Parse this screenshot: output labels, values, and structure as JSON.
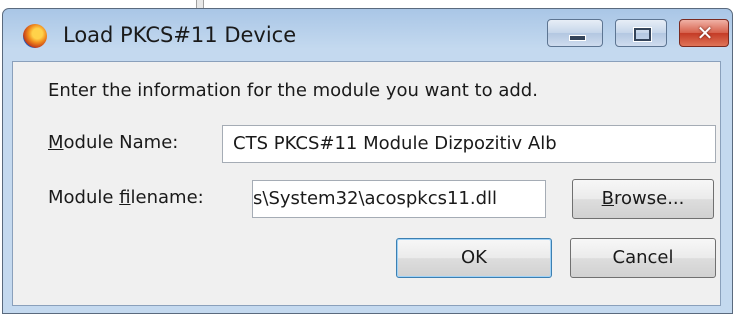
{
  "window": {
    "title": "Load PKCS#11 Device",
    "icon": "firefox-icon"
  },
  "caption_buttons": {
    "minimize": "minimize-icon",
    "maximize": "maximize-icon",
    "close": "✕"
  },
  "dialog": {
    "instructions": "Enter the information for the module you want to add.",
    "module_name_label_accel": "M",
    "module_name_label_rest": "odule Name:",
    "module_name_value": "CTS PKCS#11 Module Dizpozitiv Alb",
    "module_filename_label_pre": "Module ",
    "module_filename_label_accel": "f",
    "module_filename_label_rest": "ilename:",
    "module_filename_value": "s\\System32\\acospkcs11.dll",
    "browse_accel": "B",
    "browse_rest": "rowse...",
    "ok_label": "OK",
    "cancel_label": "Cancel"
  },
  "colors": {
    "title_bar": "#c4d9ef",
    "close_button": "#c43b26",
    "default_button_border": "#3c7fb1"
  }
}
